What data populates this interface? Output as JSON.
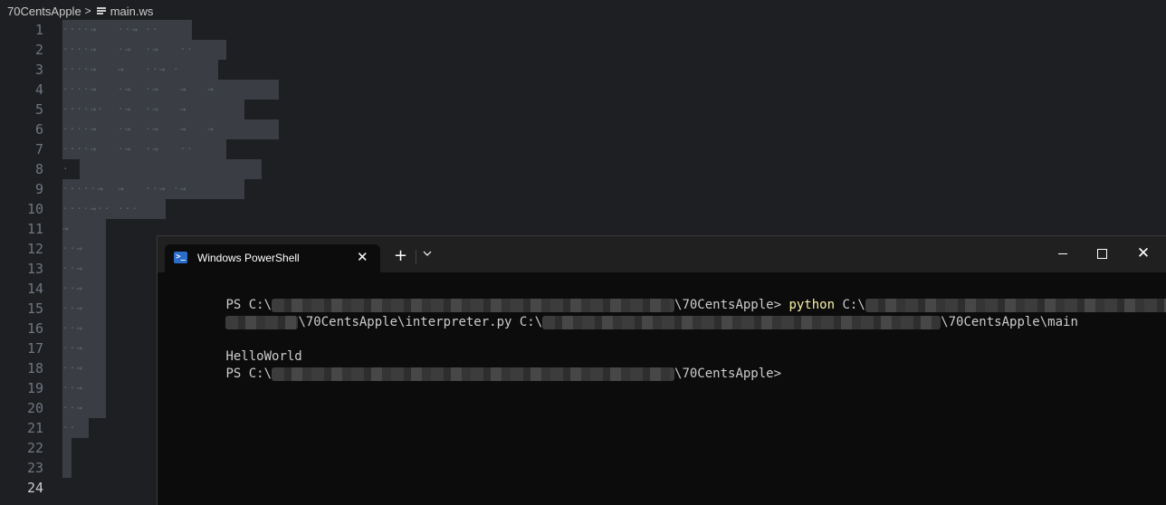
{
  "breadcrumb": {
    "folder": "70CentsApple",
    "separator": ">",
    "file": "main.ws",
    "file_icon": "lines-file-icon"
  },
  "editor": {
    "line_numbers": [
      "1",
      "2",
      "3",
      "4",
      "5",
      "6",
      "7",
      "8",
      "9",
      "10",
      "11",
      "12",
      "13",
      "14",
      "15",
      "16",
      "17",
      "18",
      "19",
      "20",
      "21",
      "22",
      "23",
      "24"
    ],
    "current_line": "24",
    "lines": [
      "····→   ··→ ··",
      "····→   ·→  ·→   ··",
      "····→   →   ··→ ·",
      "····→   ·→  ·→   →   →",
      "····→·  ·→  ·→   →",
      "····→   ·→  ·→   →   →",
      "····→   ·→  ·→   ··",
      "·",
      "·····→  →   ··→ ·→",
      "····→·· ···",
      "→",
      "··→",
      "··→",
      "··→",
      "··→",
      "··→",
      "··→",
      "··→",
      "··→",
      "··→",
      "··",
      "",
      "",
      ""
    ]
  },
  "terminal": {
    "tab_title": "Windows PowerShell",
    "tab_icon": "powershell-icon",
    "close_tab": "✕",
    "new_tab": "+",
    "dropdown": "chevron-down-icon",
    "window_close": "✕",
    "lines": {
      "l1_a": "PS C:\\",
      "l1_b": "\\70CentsApple> ",
      "l1_c": "python",
      "l1_d": " C:\\",
      "l2_a": "\\70CentsApple\\interpreter.py C:\\",
      "l2_b": "\\70CentsApple\\main",
      "l4": "HelloWorld",
      "l5_a": "PS C:\\",
      "l5_b": "\\70CentsApple>"
    }
  },
  "colors": {
    "editor_bg": "#1e1f22",
    "selection": "#3a3d44",
    "terminal_bg": "#0c0c0c",
    "command_yellow": "#f9f1a5"
  }
}
